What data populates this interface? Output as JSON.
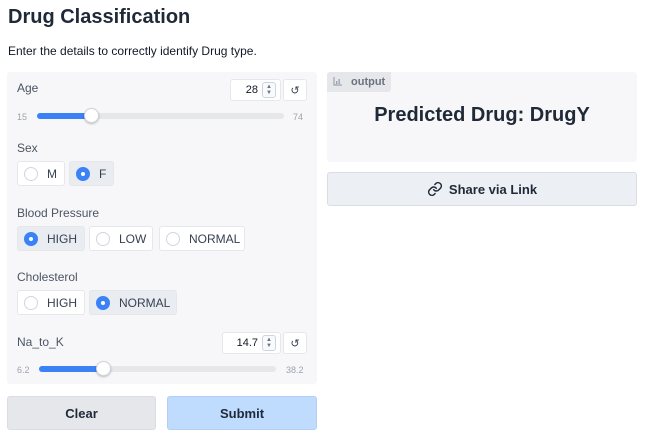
{
  "header": {
    "title": "Drug Classification",
    "description": "Enter the details to correctly identify Drug type."
  },
  "inputs": {
    "age": {
      "label": "Age",
      "value": "28",
      "min": "15",
      "max": "74",
      "fraction": 0.22
    },
    "sex": {
      "label": "Sex",
      "options": [
        "M",
        "F"
      ],
      "selected": "F"
    },
    "blood_pressure": {
      "label": "Blood Pressure",
      "options": [
        "HIGH",
        "LOW",
        "NORMAL"
      ],
      "selected": "HIGH"
    },
    "cholesterol": {
      "label": "Cholesterol",
      "options": [
        "HIGH",
        "NORMAL"
      ],
      "selected": "NORMAL"
    },
    "na_to_k": {
      "label": "Na_to_K",
      "value": "14.7",
      "min": "6.2",
      "max": "38.2",
      "fraction": 0.27
    }
  },
  "output": {
    "tag": "output",
    "prediction": "Predicted Drug: DrugY",
    "share_label": "Share via Link"
  },
  "actions": {
    "clear_label": "Clear",
    "submit_label": "Submit"
  },
  "colors": {
    "accent": "#3b82f6",
    "submit_bg": "#bfdbfe",
    "panel_bg": "#f7f7f9"
  },
  "icons": {
    "reset": "reset-icon",
    "spinner": "spinner-arrows-icon",
    "output": "chart-icon",
    "share": "link-icon"
  }
}
